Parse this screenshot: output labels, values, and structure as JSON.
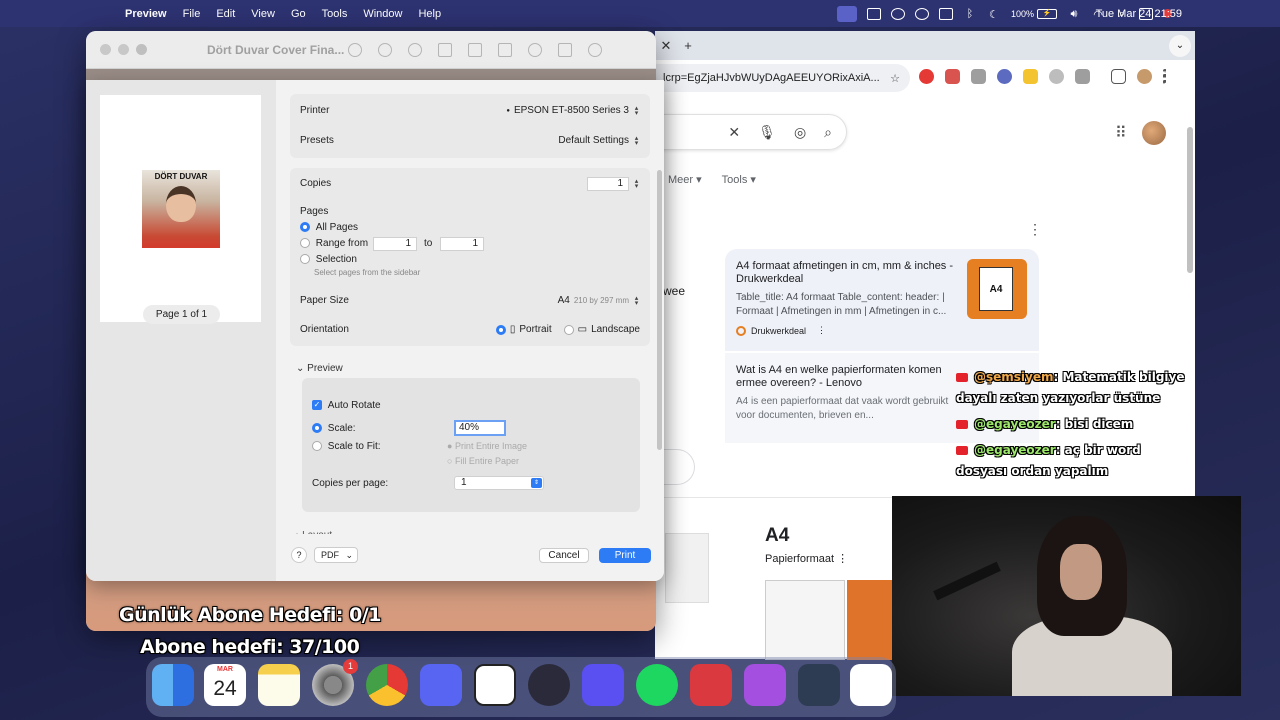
{
  "menubar": {
    "app": "Preview",
    "items": [
      "File",
      "Edit",
      "View",
      "Go",
      "Tools",
      "Window",
      "Help"
    ],
    "battery": "100%",
    "clock": "Tue Mar 24  21:59"
  },
  "preview_window": {
    "title": "Dört Duvar Cover Fina..."
  },
  "print_dialog": {
    "thumbnail_title": "DÖRT DUVAR",
    "page_indicator": "Page 1 of 1",
    "printer_label": "Printer",
    "printer_value": "EPSON ET-8500 Series 3",
    "presets_label": "Presets",
    "presets_value": "Default Settings",
    "copies_label": "Copies",
    "copies_value": "1",
    "pages_label": "Pages",
    "all_pages": "All Pages",
    "range_from": "Range from",
    "range_start": "1",
    "range_to": "to",
    "range_end": "1",
    "selection": "Selection",
    "selection_hint": "Select pages from the sidebar",
    "paper_size_label": "Paper Size",
    "paper_size_value": "A4",
    "paper_size_dims": "210 by 297 mm",
    "orientation_label": "Orientation",
    "portrait": "Portrait",
    "landscape": "Landscape",
    "preview_section": "Preview",
    "auto_rotate": "Auto Rotate",
    "scale_label": "Scale:",
    "scale_value": "40%",
    "scale_to_fit": "Scale to Fit:",
    "print_entire_image": "Print Entire Image",
    "fill_entire_paper": "Fill Entire Paper",
    "copies_per_page_label": "Copies per page:",
    "copies_per_page_value": "1",
    "layout_section": "Layout",
    "help": "?",
    "pdf": "PDF",
    "cancel": "Cancel",
    "print": "Print"
  },
  "browser": {
    "url": "lcrp=EgZjaHJvbWUyDAgAEEUYORixAxiA...",
    "tabs_nav": [
      "Meer",
      "Tools"
    ],
    "left_fragment": "wee",
    "result1": {
      "title": "A4 formaat afmetingen in cm, mm & inches - Drukwerkdeal",
      "snippet": "Table_title: A4 formaat Table_content: header: | Formaat | Afmetingen in mm | Afmetingen in c...",
      "source": "Drukwerkdeal",
      "thumb_label": "A4"
    },
    "result2": {
      "title": "Wat is A4 en welke papierformaten komen ermee overeen? - Lenovo",
      "snippet": "A4 is een papierformaat dat vaak wordt gebruikt voor documenten, brieven en..."
    },
    "knowledge": {
      "title": "A4",
      "subtitle": "Papierformaat"
    }
  },
  "overlay": {
    "daily_goal": "Günlük Abone Hedefi: 0/1",
    "sub_goal": "Abone hedefi: 37/100",
    "chat": [
      {
        "user": "@şemsiyem",
        "message": ": Matematik bilgiye dayalı zaten yazıyorlar üstüne"
      },
      {
        "user": "@egayeozer",
        "message": ": bisi dicem"
      },
      {
        "user": "@egayeozer",
        "message": ": aç bir word dosyası ordan yapalım"
      }
    ]
  },
  "dock": {
    "calendar_month": "MAR",
    "calendar_day": "24",
    "settings_badge": "1"
  }
}
